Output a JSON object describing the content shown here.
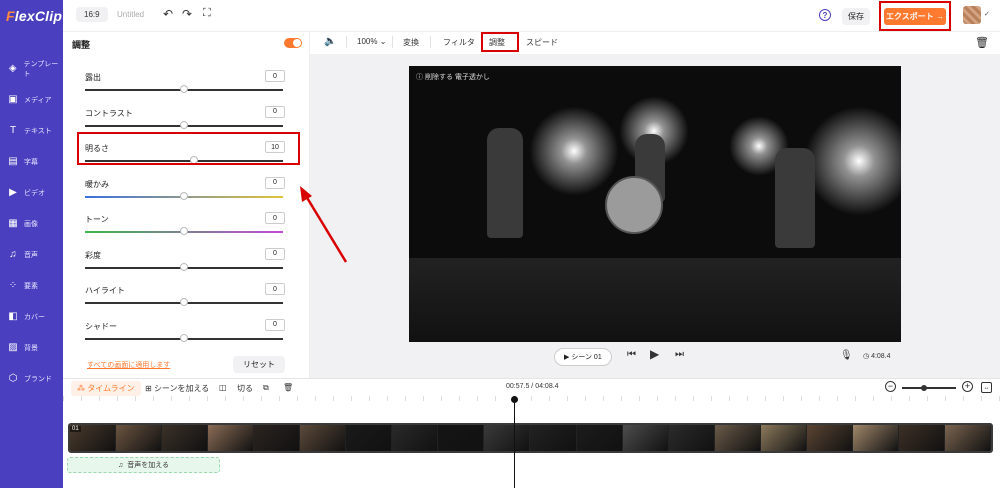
{
  "app": {
    "logo": "FlexClip",
    "title": "Untitled",
    "ratio": "16:9"
  },
  "nav": [
    {
      "label": "テンプレート",
      "icon": "layers-icon"
    },
    {
      "label": "メディア",
      "icon": "media-icon"
    },
    {
      "label": "テキスト",
      "icon": "text-icon"
    },
    {
      "label": "字幕",
      "icon": "subtitle-icon"
    },
    {
      "label": "ビデオ",
      "icon": "video-icon"
    },
    {
      "label": "画像",
      "icon": "image-icon"
    },
    {
      "label": "音声",
      "icon": "music-icon"
    },
    {
      "label": "要素",
      "icon": "elements-icon"
    },
    {
      "label": "カバー",
      "icon": "cover-icon"
    },
    {
      "label": "背景",
      "icon": "background-icon"
    },
    {
      "label": "ブランド",
      "icon": "brand-icon"
    }
  ],
  "topbar": {
    "save": "保存",
    "export": "エクスポート →"
  },
  "panel": {
    "title": "調整",
    "apply_all": "すべての画面に適用します",
    "reset": "リセット",
    "adjustments": [
      {
        "label": "露出",
        "value": "0",
        "level": 0.5,
        "track": "#333333"
      },
      {
        "label": "コントラスト",
        "value": "0",
        "level": 0.5,
        "track": "#333333"
      },
      {
        "label": "明るさ",
        "value": "10",
        "level": 0.55,
        "track": "#333333"
      },
      {
        "label": "暖かみ",
        "value": "0",
        "level": 0.5,
        "track": "linear-gradient(90deg,#3a6fe0,#e0c43a)"
      },
      {
        "label": "トーン",
        "value": "0",
        "level": 0.5,
        "track": "linear-gradient(90deg,#3ab84a,#c24ad8)"
      },
      {
        "label": "彩度",
        "value": "0",
        "level": 0.5,
        "track": "#333333"
      },
      {
        "label": "ハイライト",
        "value": "0",
        "level": 0.5,
        "track": "#333333"
      },
      {
        "label": "シャドー",
        "value": "0",
        "level": 0.5,
        "track": "#333333"
      }
    ]
  },
  "preview_toolbar": {
    "zoom": "100%",
    "transform": "変換",
    "filter": "フィルタ",
    "adjust": "調整",
    "speed": "スピード"
  },
  "preview": {
    "watermark": "ⓘ 削除する 電子透かし",
    "scene": "▶ シーン 01",
    "duration": "4:08.4"
  },
  "timeline": {
    "tab": "タイムライン",
    "add_scene": "シーンを加える",
    "cut": "切る",
    "time": "00:57.5 / 04:08.4",
    "clip_number": "01",
    "add_audio": "音声を加える"
  },
  "colors": {
    "sidebar": "#4a3fbf",
    "accent": "#ff7a2f",
    "highlight": "#d80000"
  }
}
